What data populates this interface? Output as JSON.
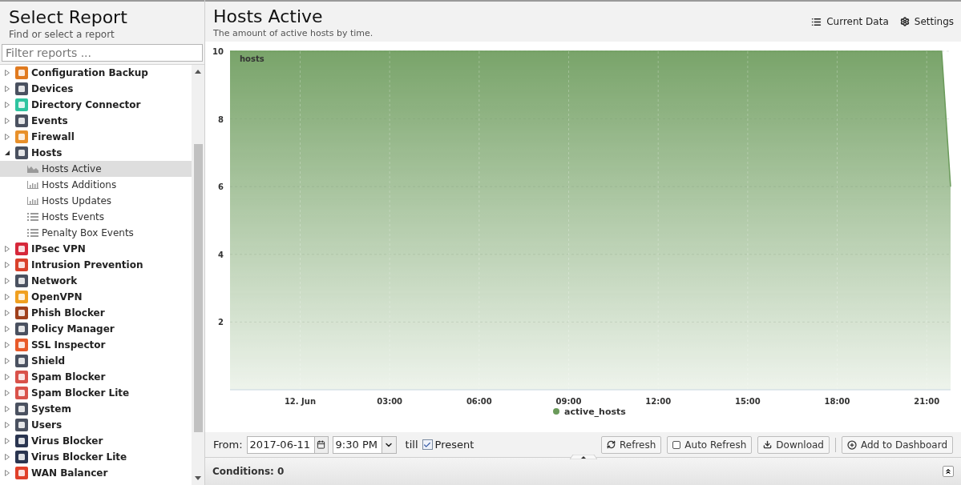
{
  "sidebar": {
    "title": "Select Report",
    "subtitle": "Find or select a report",
    "filter": {
      "placeholder": "Filter reports ..."
    },
    "items": [
      {
        "label": "Configuration Backup",
        "color": "#e07a1f",
        "expanded": false
      },
      {
        "label": "Devices",
        "color": "#4a5160",
        "expanded": false
      },
      {
        "label": "Directory Connector",
        "color": "#2ec4a0",
        "expanded": false
      },
      {
        "label": "Events",
        "color": "#4a5160",
        "expanded": false
      },
      {
        "label": "Firewall",
        "color": "#e8902a",
        "expanded": false
      },
      {
        "label": "Hosts",
        "color": "#4a5160",
        "expanded": true,
        "children": [
          {
            "label": "Hosts Active",
            "kind": "area",
            "selected": true
          },
          {
            "label": "Hosts Additions",
            "kind": "bar",
            "selected": false
          },
          {
            "label": "Hosts Updates",
            "kind": "bar",
            "selected": false
          },
          {
            "label": "Hosts Events",
            "kind": "list",
            "selected": false
          },
          {
            "label": "Penalty Box Events",
            "kind": "list",
            "selected": false
          }
        ]
      },
      {
        "label": "IPsec VPN",
        "color": "#d6283a",
        "expanded": false
      },
      {
        "label": "Intrusion Prevention",
        "color": "#d9412b",
        "expanded": false
      },
      {
        "label": "Network",
        "color": "#4a5160",
        "expanded": false
      },
      {
        "label": "OpenVPN",
        "color": "#f0a020",
        "expanded": false
      },
      {
        "label": "Phish Blocker",
        "color": "#a0401c",
        "expanded": false
      },
      {
        "label": "Policy Manager",
        "color": "#4a5160",
        "expanded": false
      },
      {
        "label": "SSL Inspector",
        "color": "#e85a2a",
        "expanded": false
      },
      {
        "label": "Shield",
        "color": "#4a5160",
        "expanded": false
      },
      {
        "label": "Spam Blocker",
        "color": "#d9524a",
        "expanded": false
      },
      {
        "label": "Spam Blocker Lite",
        "color": "#d9524a",
        "expanded": false
      },
      {
        "label": "System",
        "color": "#4a5160",
        "expanded": false
      },
      {
        "label": "Users",
        "color": "#4a5160",
        "expanded": false
      },
      {
        "label": "Virus Blocker",
        "color": "#2a3550",
        "expanded": false
      },
      {
        "label": "Virus Blocker Lite",
        "color": "#2a3550",
        "expanded": false
      },
      {
        "label": "WAN Balancer",
        "color": "#e0402a",
        "expanded": false
      }
    ]
  },
  "report": {
    "title": "Hosts Active",
    "description": "The amount of active hosts by time.",
    "actions": [
      {
        "label": "Current Data",
        "kind": "list"
      },
      {
        "label": "Settings",
        "kind": "gear"
      }
    ],
    "chart_data": {
      "type": "area",
      "ylabel": "hosts",
      "x": [
        -2.35,
        21.5,
        21.8
      ],
      "series": [
        {
          "name": "active_hosts",
          "color": "#6a9a5a",
          "values": [
            10,
            10,
            6
          ]
        }
      ],
      "xlim": [
        -2.35,
        21.8
      ],
      "ylim": [
        0,
        10
      ],
      "grid": true,
      "yticks": [
        2,
        4,
        6,
        8,
        10
      ],
      "xticks": [
        {
          "value": 0,
          "label": "12. Jun"
        },
        {
          "value": 3,
          "label": "03:00"
        },
        {
          "value": 6,
          "label": "06:00"
        },
        {
          "value": 9,
          "label": "09:00"
        },
        {
          "value": 12,
          "label": "12:00"
        },
        {
          "value": 15,
          "label": "15:00"
        },
        {
          "value": 18,
          "label": "18:00"
        },
        {
          "value": 21,
          "label": "21:00"
        }
      ]
    }
  },
  "toolbar": {
    "from_label": "From:",
    "date": "2017-06-11",
    "time": "9:30 PM",
    "till_label": "till",
    "present": {
      "label": "Present",
      "checked": true
    },
    "buttons": [
      {
        "label": "Refresh",
        "kind": "refresh"
      },
      {
        "label": "Auto Refresh",
        "kind": "checkbox",
        "checked": false
      },
      {
        "label": "Download",
        "kind": "download"
      },
      {
        "label": "Add to Dashboard",
        "kind": "add"
      }
    ]
  },
  "conditions": {
    "label": "Conditions: 0"
  }
}
